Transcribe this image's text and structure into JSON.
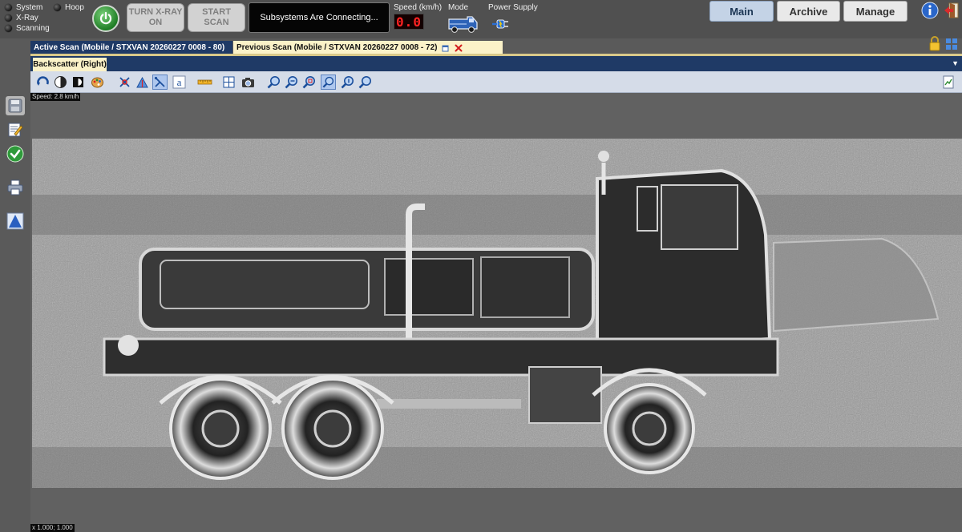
{
  "indicators": {
    "system": "System",
    "xray": "X-Ray",
    "scanning": "Scanning",
    "hoop": "Hoop"
  },
  "controls": {
    "turn_xray_line1": "TURN X-RAY",
    "turn_xray_line2": "ON",
    "start_scan": "START SCAN"
  },
  "status_message": "Subsystems Are Connecting...",
  "speed": {
    "label": "Speed (km/h)",
    "value": "0.0"
  },
  "mode": {
    "label": "Mode"
  },
  "power_supply": {
    "label": "Power Supply"
  },
  "nav": {
    "main": "Main",
    "archive": "Archive",
    "manage": "Manage"
  },
  "tabs": {
    "active_scan": "Active Scan (Mobile / STXVAN 20260227 0008 - 80)",
    "previous_scan": "Previous Scan (Mobile / STXVAN 20260227 0008 - 72)"
  },
  "view": {
    "subtab": "Backscatter (Right)",
    "speed_overlay": "Speed: 2.8 km/h",
    "zoom_overlay": "x 1.000; 1.000"
  },
  "toolbar_icons": [
    "rotate-icon",
    "contrast-icon",
    "invert-icon",
    "palette-icon",
    "crosshair-tool-icon",
    "measure-tool-icon",
    "select-tool-icon",
    "text-annotation-icon",
    "ruler-icon",
    "grid-icon",
    "camera-icon",
    "zoom-in-icon",
    "zoom-out-icon",
    "zoom-region-icon",
    "zoom-fit-icon",
    "zoom-actual-icon",
    "zoom-icon",
    "export-icon"
  ],
  "colors": {
    "accent_navy": "#1f3a66",
    "tab_highlight": "#fbf2c8",
    "power_green": "#2b8a30",
    "speed_red": "#ff2222"
  }
}
